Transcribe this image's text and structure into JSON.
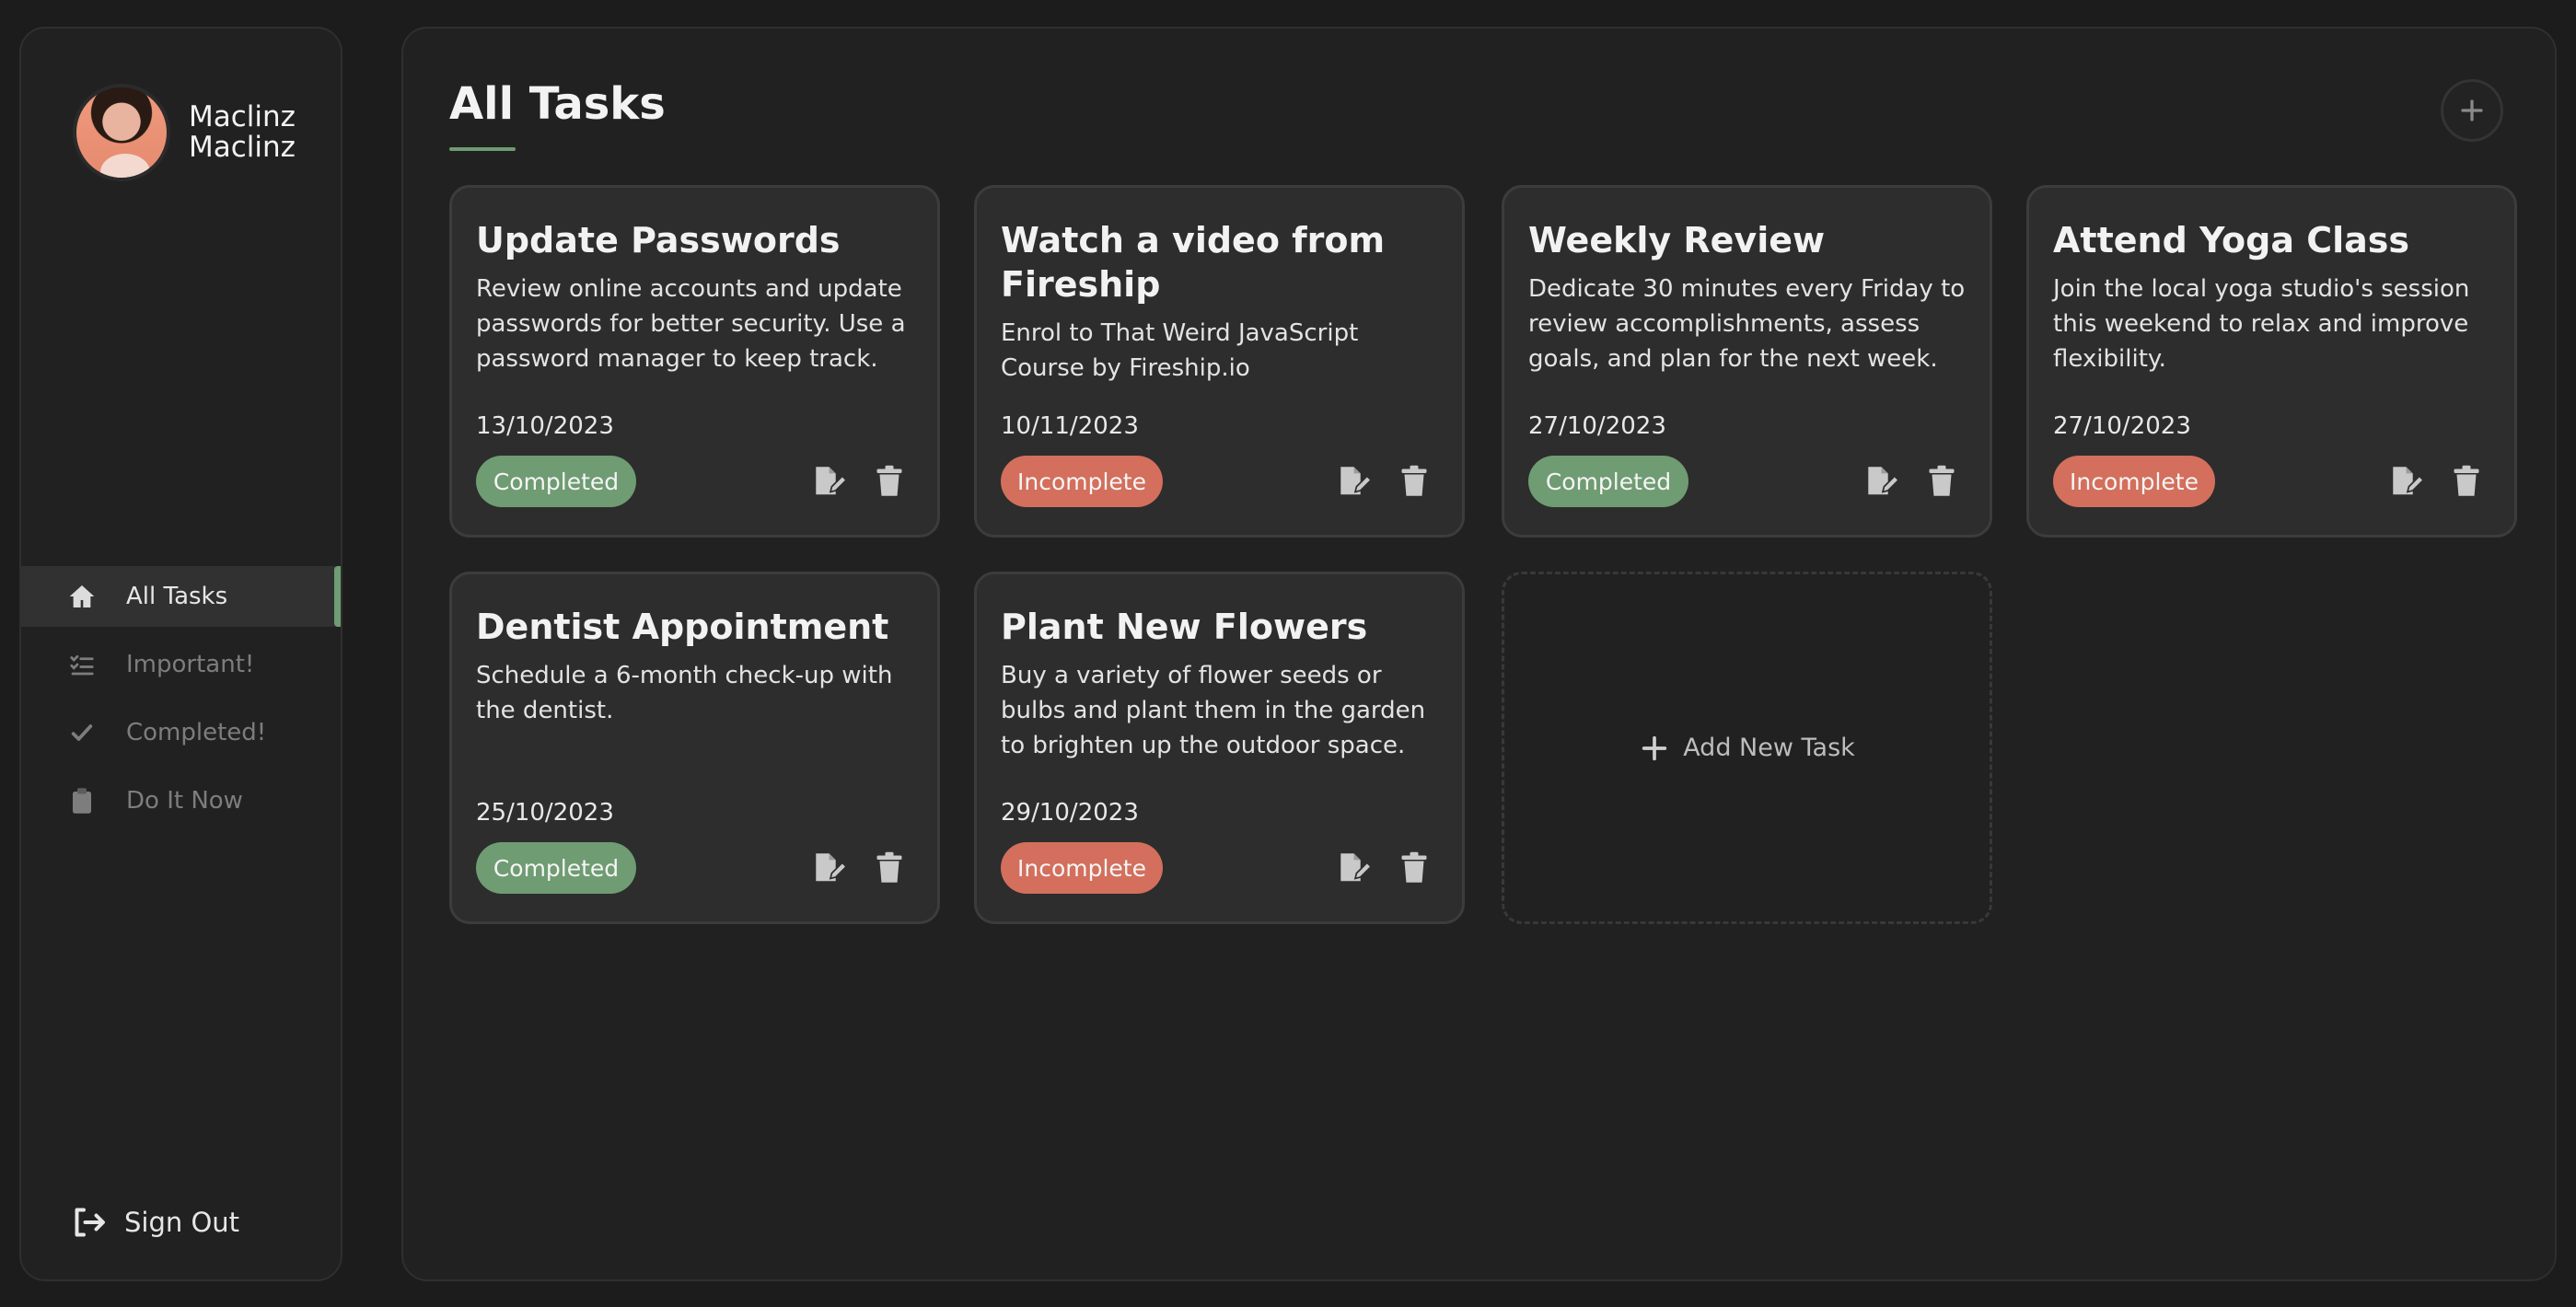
{
  "sidebar": {
    "profile": {
      "name_line1": "Maclinz",
      "name_line2": "Maclinz"
    },
    "nav": [
      {
        "label": "All Tasks",
        "icon": "home-icon",
        "active": true
      },
      {
        "label": "Important!",
        "icon": "list-check-icon",
        "active": false
      },
      {
        "label": "Completed!",
        "icon": "check-icon",
        "active": false
      },
      {
        "label": "Do It Now",
        "icon": "clipboard-icon",
        "active": false
      }
    ],
    "signout_label": "Sign Out"
  },
  "main": {
    "title": "All Tasks",
    "add_task_label": "Add New Task",
    "tasks": [
      {
        "title": "Update Passwords",
        "description": "Review online accounts and update passwords for better security. Use a password manager to keep track.",
        "date": "13/10/2023",
        "status": "Completed"
      },
      {
        "title": "Watch a video from Fireship",
        "description": "Enrol to That Weird JavaScript Course by Fireship.io",
        "date": "10/11/2023",
        "status": "Incomplete"
      },
      {
        "title": "Weekly Review",
        "description": "Dedicate 30 minutes every Friday to review accomplishments, assess goals, and plan for the next week.",
        "date": "27/10/2023",
        "status": "Completed"
      },
      {
        "title": "Attend Yoga Class",
        "description": "Join the local yoga studio's session this weekend to relax and improve flexibility.",
        "date": "27/10/2023",
        "status": "Incomplete"
      },
      {
        "title": "Dentist Appointment",
        "description": "Schedule a 6-month check-up with the dentist.",
        "date": "25/10/2023",
        "status": "Completed"
      },
      {
        "title": "Plant New Flowers",
        "description": "Buy a variety of flower seeds or bulbs and plant them in the garden to brighten up the outdoor space.",
        "date": "29/10/2023",
        "status": "Incomplete"
      }
    ]
  },
  "colors": {
    "accent": "#6f9c72",
    "completed": "#6f9c72",
    "incomplete": "#d36f5c",
    "background": "#1c1c1c",
    "panel": "#212121",
    "card": "#2d2d2d"
  }
}
